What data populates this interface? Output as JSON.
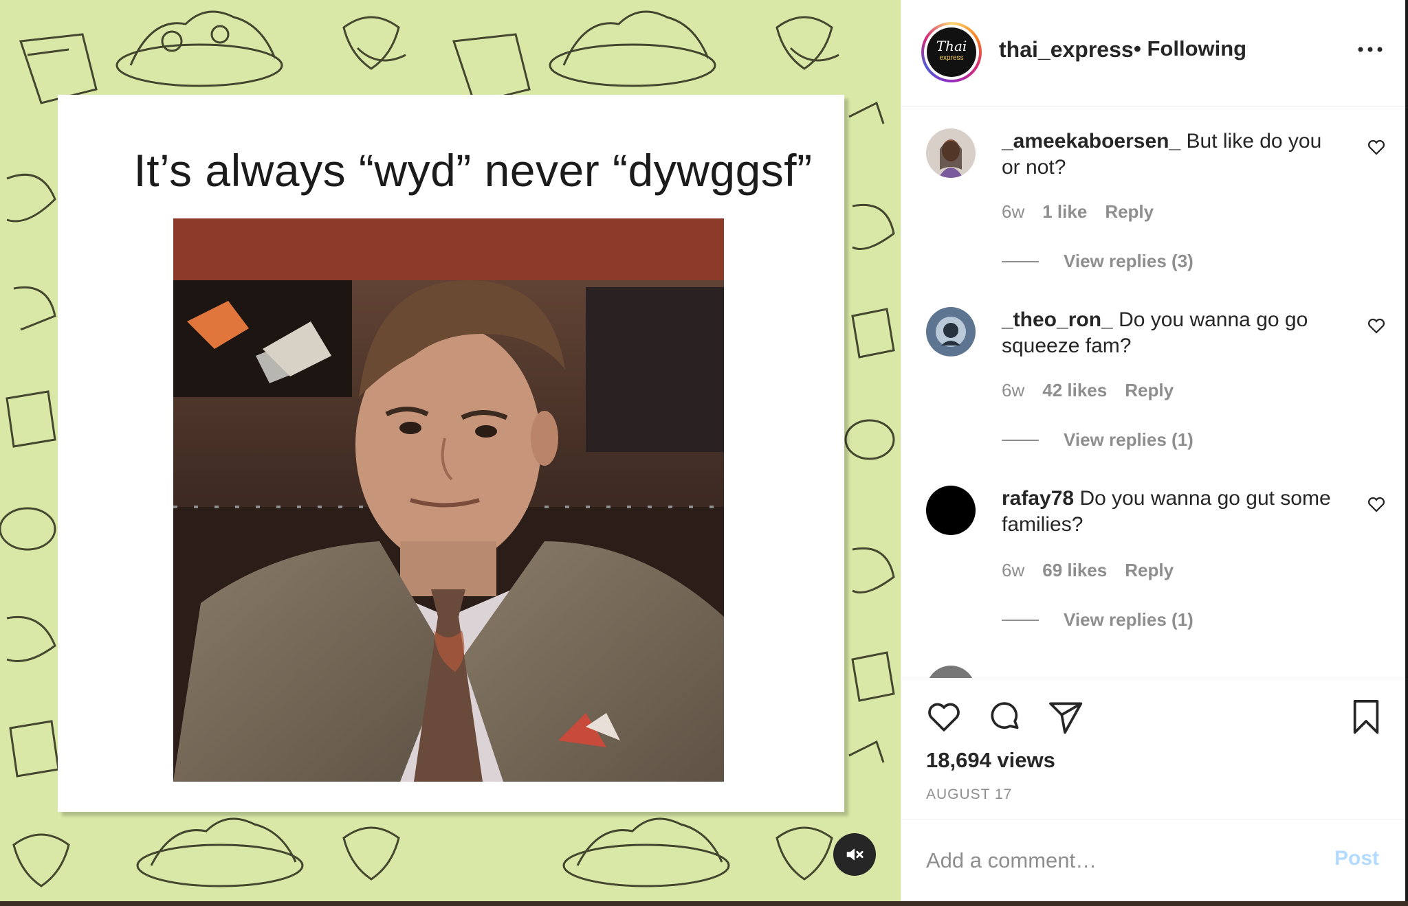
{
  "post": {
    "meme_caption": "It’s always “wyd” never “dywggsf”",
    "mute_icon": "speaker-muted-icon"
  },
  "header": {
    "username": "thai_express",
    "separator": "•",
    "follow_status": "Following",
    "avatar_text": "Thai",
    "avatar_subtext": "express",
    "more_icon": "more-horizontal-icon"
  },
  "comments": [
    {
      "username": "_ameekaboersen_",
      "text": "But like do you or not?",
      "age": "6w",
      "likes": "1 like",
      "reply_label": "Reply",
      "view_replies": "View replies (3)"
    },
    {
      "username": "_theo_ron_",
      "text": "Do you wanna go go squeeze fam?",
      "age": "6w",
      "likes": "42 likes",
      "reply_label": "Reply",
      "view_replies": "View replies (1)"
    },
    {
      "username": "rafay78",
      "text": "Do you wanna go gut some families?",
      "age": "6w",
      "likes": "69 likes",
      "reply_label": "Reply",
      "view_replies": "View replies (1)"
    }
  ],
  "actions": {
    "like_icon": "heart-icon",
    "comment_icon": "comment-bubble-icon",
    "share_icon": "paper-plane-icon",
    "save_icon": "bookmark-icon",
    "views": "18,694 views",
    "date": "AUGUST 17"
  },
  "composer": {
    "placeholder": "Add a comment…",
    "post_label": "Post",
    "post_color": "#b3dbff"
  },
  "colors": {
    "media_background": "#d9e8a6",
    "text_primary": "#262626",
    "text_secondary": "#8e8e8e"
  }
}
